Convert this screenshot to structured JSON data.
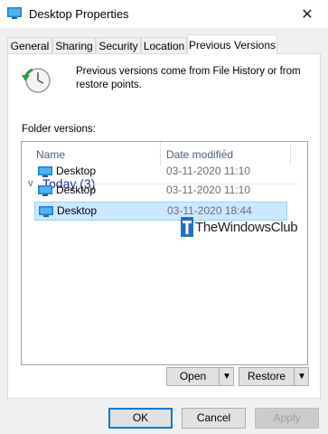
{
  "window": {
    "title": "Desktop Properties",
    "close_glyph": "✕"
  },
  "tabs": [
    {
      "label": "General"
    },
    {
      "label": "Sharing"
    },
    {
      "label": "Security"
    },
    {
      "label": "Location"
    },
    {
      "label": "Previous Versions",
      "active": true
    }
  ],
  "description": "Previous versions come from File History or from restore points.",
  "folder_versions_label": "Folder versions:",
  "columns": {
    "name": "Name",
    "date_modified": "Date modified"
  },
  "group": {
    "chevron": "v",
    "label": "Today (3)"
  },
  "rows": [
    {
      "name": "Desktop",
      "date": "03-11-2020 11:10",
      "selected": false
    },
    {
      "name": "Desktop",
      "date": "03-11-2020 11:10",
      "selected": false
    },
    {
      "name": "Desktop",
      "date": "03-11-2020 18:44",
      "selected": true
    }
  ],
  "watermark": {
    "text": "TheWindowsClub"
  },
  "actions": {
    "open": "Open",
    "restore": "Restore"
  },
  "dialog_buttons": {
    "ok": "OK",
    "cancel": "Cancel",
    "apply": "Apply"
  },
  "colors": {
    "accent": "#0078d7",
    "selection": "#cce8ff",
    "group_text": "#1e3287"
  },
  "icons": [
    "folder-desktop-icon",
    "history-clock-icon",
    "close-icon",
    "dropdown-arrow-icon"
  ]
}
